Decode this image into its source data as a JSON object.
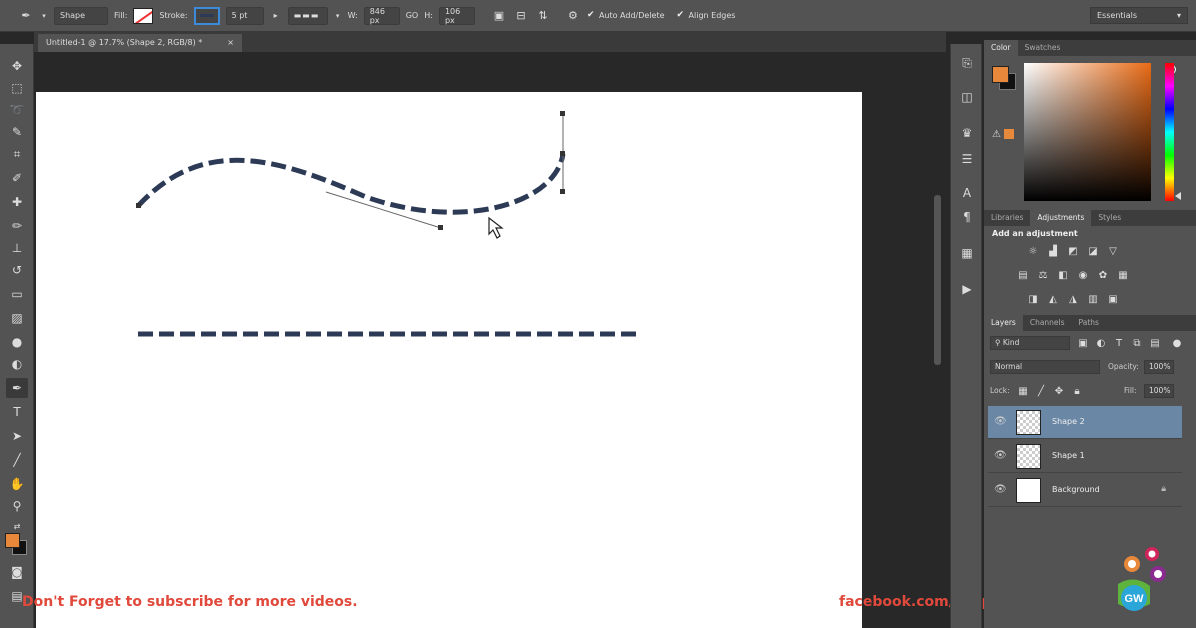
{
  "options_bar": {
    "tool_mode": "Shape",
    "fill_label": "Fill:",
    "stroke_label": "Stroke:",
    "stroke_width": "5 pt",
    "width_label": "W:",
    "width_value": "846 px",
    "link_label": "GO",
    "height_label": "H:",
    "height_value": "106 px",
    "auto_add_delete": "Auto Add/Delete",
    "align_edges": "Align Edges",
    "workspace": "Essentials"
  },
  "document": {
    "tab_title": "Untitled-1 @ 17.7% (Shape 2, RGB/8) *",
    "close": "×"
  },
  "overlay": {
    "subscribe_text": "Don't Forget to subscribe for more videos.",
    "facebook_text": "facebook.com/GraphicWorkers"
  },
  "color_panel": {
    "tabs": [
      "Color",
      "Swatches"
    ],
    "foreground": "#e8883a",
    "background": "#111111"
  },
  "adjustments_panel": {
    "tabs": [
      "Libraries",
      "Adjustments",
      "Styles"
    ],
    "title": "Add an adjustment"
  },
  "layers_panel": {
    "tabs": [
      "Layers",
      "Channels",
      "Paths"
    ],
    "filter_kind": "Kind",
    "blend_mode": "Normal",
    "opacity_label": "Opacity:",
    "opacity_value": "100%",
    "lock_label": "Lock:",
    "fill_label": "Fill:",
    "fill_value": "100%",
    "layers": [
      {
        "name": "Shape 2",
        "selected": true
      },
      {
        "name": "Shape 1",
        "selected": false
      },
      {
        "name": "Background",
        "selected": false
      }
    ]
  },
  "logo": {
    "text": "GW"
  },
  "colors": {
    "ui_bg": "#535353",
    "dark_bg": "#282828",
    "accent_orange": "#e8883a",
    "overlay_red": "#e0493b",
    "stroke_navy": "#2c3a55",
    "selection_blue": "#6b87a6"
  }
}
